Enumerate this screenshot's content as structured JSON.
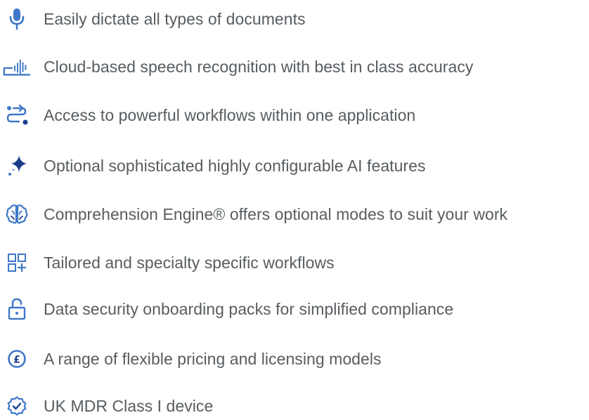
{
  "colors": {
    "icon_primary": "#3f78c8",
    "icon_dark": "#1a3e8c",
    "text": "#575c60"
  },
  "features": [
    {
      "icon": "microphone-icon",
      "text": "Easily dictate all types of documents"
    },
    {
      "icon": "cloud-waveform-icon",
      "text": "Cloud-based speech recognition with best in class accuracy"
    },
    {
      "icon": "workflow-arrows-icon",
      "text": "Access to powerful workflows within one application"
    },
    {
      "icon": "sparkle-icon",
      "text": "Optional sophisticated highly configurable AI features"
    },
    {
      "icon": "brain-icon",
      "text": "Comprehension Engine® offers optional modes to suit your work"
    },
    {
      "icon": "grid-plus-icon",
      "text": "Tailored and specialty specific workflows"
    },
    {
      "icon": "padlock-icon",
      "text": "Data security onboarding packs for simplified compliance"
    },
    {
      "icon": "pound-coin-icon",
      "text": "A range of flexible pricing and licensing models"
    },
    {
      "icon": "verified-badge-icon",
      "text": "UK MDR Class I device"
    }
  ]
}
